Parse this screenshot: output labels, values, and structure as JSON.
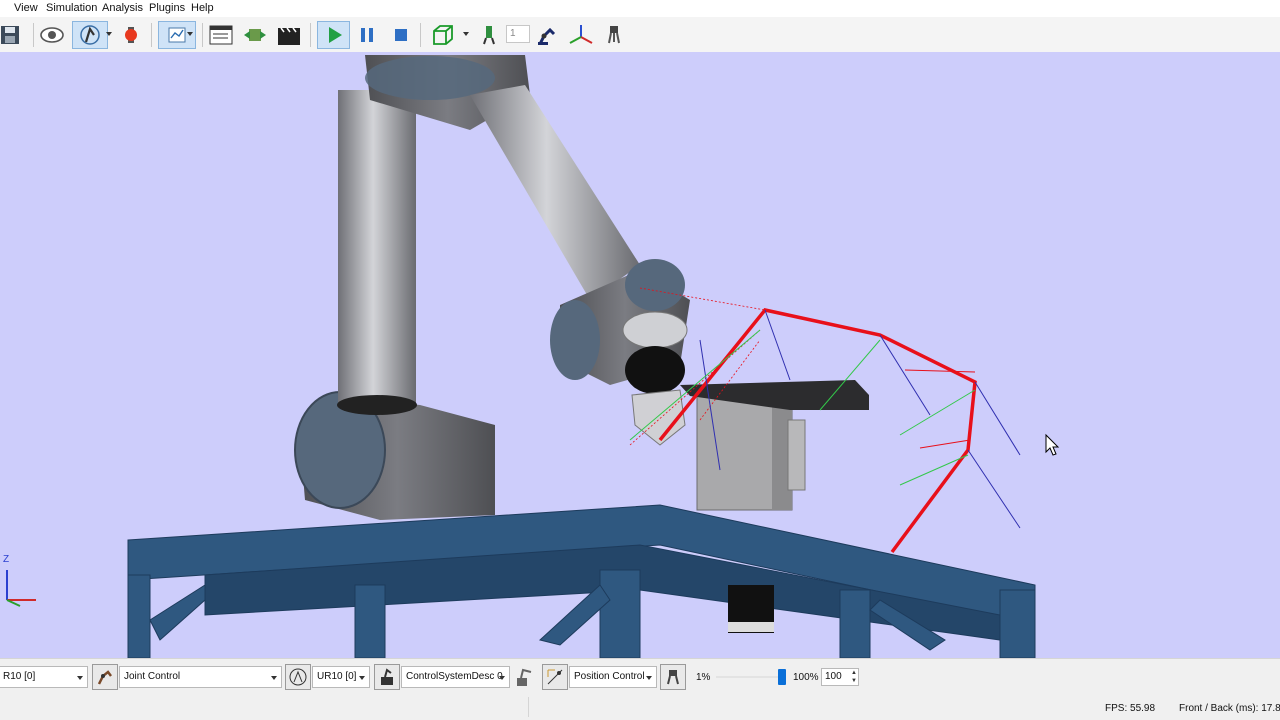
{
  "menu": {
    "view": "View",
    "simulation": "Simulation",
    "analysis": "Analysis",
    "plugins": "Plugins",
    "help": "Help"
  },
  "toolbar": {
    "frame_spin_value": "1"
  },
  "controls": {
    "device_combo": "R10 [0]",
    "control_mode_combo": "Joint Control",
    "robot_combo": "UR10 [0]",
    "control_system_combo": "ControlSystemDesc 0",
    "position_mode_combo": "Position Control",
    "speed_min_label": "1%",
    "speed_max_label": "100%",
    "speed_value": "100",
    "speed_level_percent": 100
  },
  "axis_gizmo": {
    "z_label": "Z"
  },
  "status": {
    "fps": "FPS: 55.98",
    "front_back": "Front / Back (ms):  17.8"
  },
  "colors": {
    "viewport_bg": "#cdcdfb",
    "trajectory": "#e8101a",
    "table": "#2e5680",
    "robot_gray": "#8c8c92",
    "robot_cap": "#56687c"
  }
}
